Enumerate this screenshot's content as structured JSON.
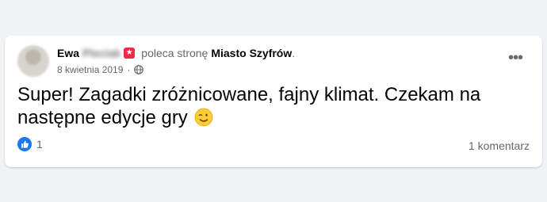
{
  "post": {
    "author_first": "Ewa",
    "author_last_blurred": "Pleciak",
    "badge_icon": "star-badge-icon",
    "recommends_text": "poleca stronę",
    "page_name": "Miasto Szyfrów",
    "page_dot": ".",
    "date": "8 kwietnia 2019",
    "audience_icon": "globe-icon",
    "text": "Super! Zagadki zróżnicowane, fajny klimat. Czekam na następne edycje gry",
    "emoji_icon": "winking-face-emoji",
    "more_icon": "more-options-icon",
    "more_label": "•••",
    "like_icon": "like-icon",
    "like_count": "1",
    "comments_label": "1 komentarz"
  },
  "colors": {
    "background": "#f0f2f5",
    "card": "#ffffff",
    "text_primary": "#050505",
    "text_secondary": "#65676b",
    "like_blue": "#1877f2",
    "badge_red": "#f02849"
  }
}
